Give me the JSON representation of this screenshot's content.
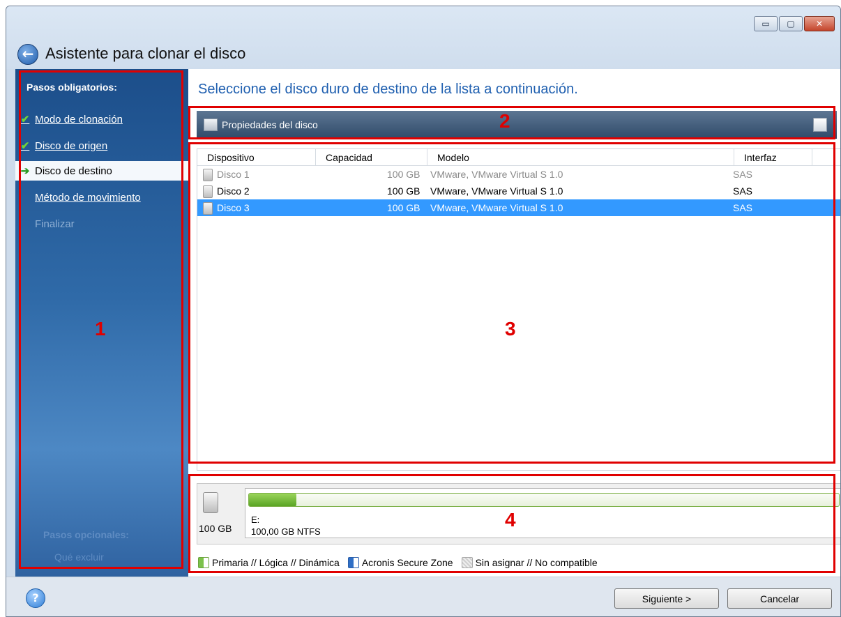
{
  "window": {
    "title": "Asistente para clonar el disco",
    "controls": {
      "minimize": "▭",
      "maximize": "▢",
      "close": "✕"
    }
  },
  "sidebar": {
    "header": "Pasos obligatorios:",
    "steps": [
      {
        "label": "Modo de clonación",
        "state": "done"
      },
      {
        "label": "Disco de origen",
        "state": "done"
      },
      {
        "label": "Disco de destino",
        "state": "current"
      },
      {
        "label": "Método de movimiento",
        "state": "link"
      },
      {
        "label": "Finalizar",
        "state": "disabled"
      }
    ],
    "optional_header": "Pasos opcionales:",
    "optional_item": "Qué excluir"
  },
  "main": {
    "instruction": "Seleccione el disco duro de destino de la lista a continuación.",
    "toolbar": {
      "properties_label": "Propiedades del disco"
    },
    "table": {
      "columns": [
        "Dispositivo",
        "Capacidad",
        "Modelo",
        "Interfaz"
      ],
      "rows": [
        {
          "device": "Disco 1",
          "capacity": "100 GB",
          "model": "VMware, VMware Virtual S 1.0",
          "interface": "SAS",
          "state": "dim"
        },
        {
          "device": "Disco 2",
          "capacity": "100 GB",
          "model": "VMware, VMware Virtual S 1.0",
          "interface": "SAS",
          "state": "normal"
        },
        {
          "device": "Disco 3",
          "capacity": "100 GB",
          "model": "VMware, VMware Virtual S 1.0",
          "interface": "SAS",
          "state": "selected"
        }
      ]
    },
    "disk_panel": {
      "capacity": "100 GB",
      "partition_letter": "E:",
      "partition_info": "100,00 GB  NTFS",
      "used_fraction": 0.08
    },
    "legend": {
      "primary": "Primaria // Lógica // Dinámica",
      "secure_zone": "Acronis Secure Zone",
      "unallocated": "Sin asignar // No compatible"
    }
  },
  "footer": {
    "next": "Siguiente >",
    "cancel": "Cancelar",
    "help": "?"
  },
  "callouts": [
    "1",
    "2",
    "3",
    "4"
  ],
  "colors": {
    "callout": "#e00000",
    "selection": "#3399ff",
    "instruction": "#2060b0"
  }
}
